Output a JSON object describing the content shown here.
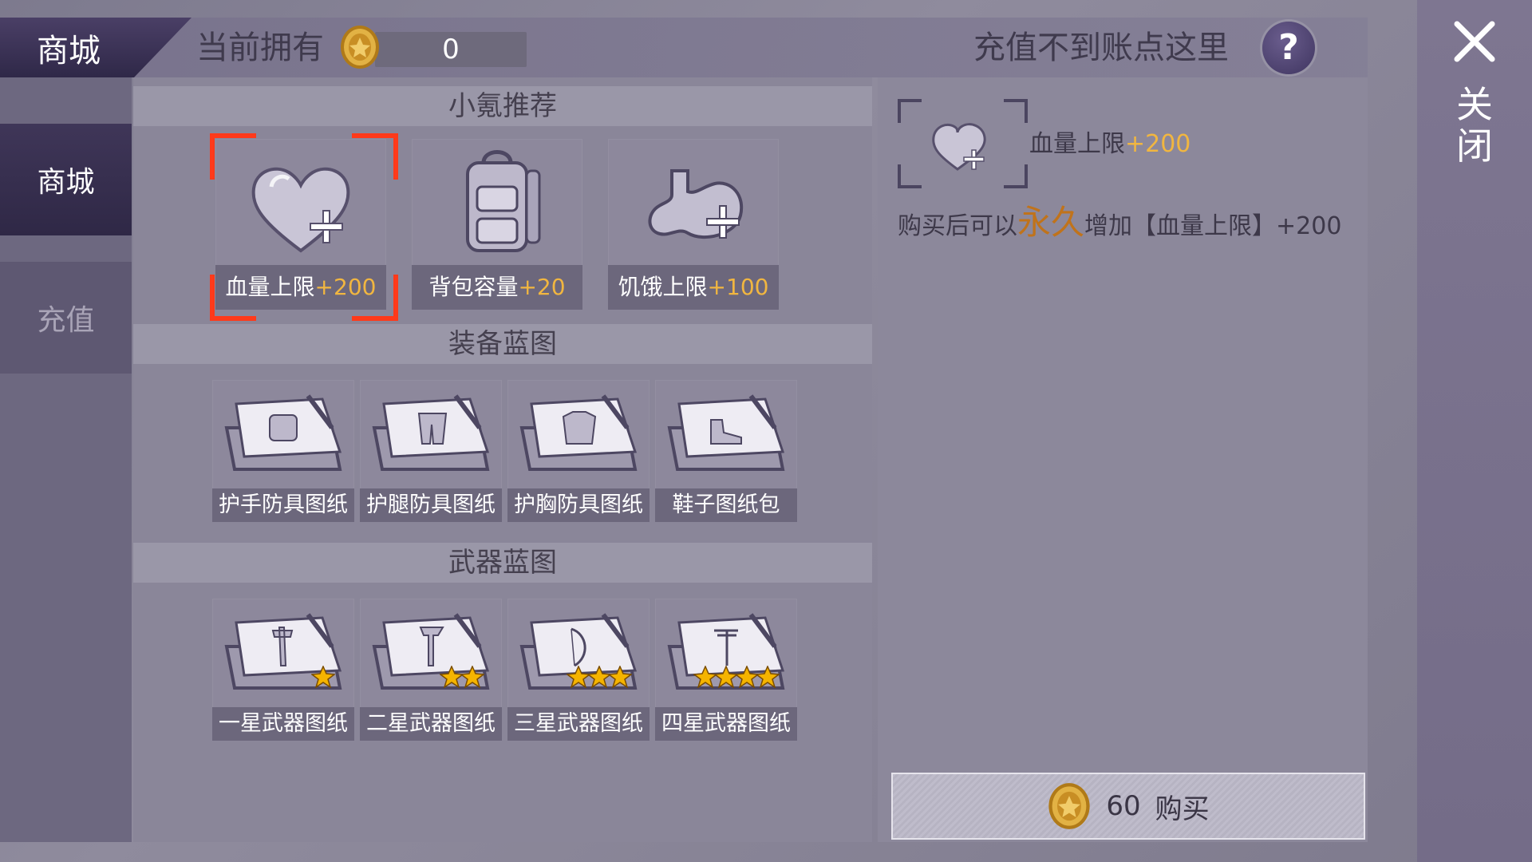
{
  "header": {
    "shop_title": "商城",
    "own_label": "当前拥有",
    "coin_balance": "0",
    "recharge_issue": "充值不到账点这里",
    "help_symbol": "?"
  },
  "close": {
    "label": "关闭"
  },
  "sidebar": {
    "items": [
      {
        "label": "商城"
      },
      {
        "label": "充值"
      }
    ]
  },
  "sections": {
    "recommend": {
      "title": "小氪推荐",
      "items": [
        {
          "name": "血量上限",
          "bonus": "+200"
        },
        {
          "name": "背包容量",
          "bonus": "+20"
        },
        {
          "name": "饥饿上限",
          "bonus": "+100"
        }
      ]
    },
    "equipment": {
      "title": "装备蓝图",
      "items": [
        {
          "name": "护手防具图纸"
        },
        {
          "name": "护腿防具图纸"
        },
        {
          "name": "护胸防具图纸"
        },
        {
          "name": "鞋子图纸包"
        }
      ]
    },
    "weapons": {
      "title": "武器蓝图",
      "items": [
        {
          "name": "一星武器图纸",
          "stars": 1
        },
        {
          "name": "二星武器图纸",
          "stars": 2
        },
        {
          "name": "三星武器图纸",
          "stars": 3
        },
        {
          "name": "四星武器图纸",
          "stars": 4
        }
      ]
    }
  },
  "detail": {
    "name": "血量上限",
    "bonus": "+200",
    "desc_prefix": "购买后可以",
    "desc_emphasis": "永久",
    "desc_suffix": "增加【血量上限】+200",
    "price": "60",
    "buy_label": "购买"
  },
  "colors": {
    "accent_orange": "#f1b640",
    "selection_red": "#ff3a1a",
    "permanent_text": "#c0731b"
  }
}
